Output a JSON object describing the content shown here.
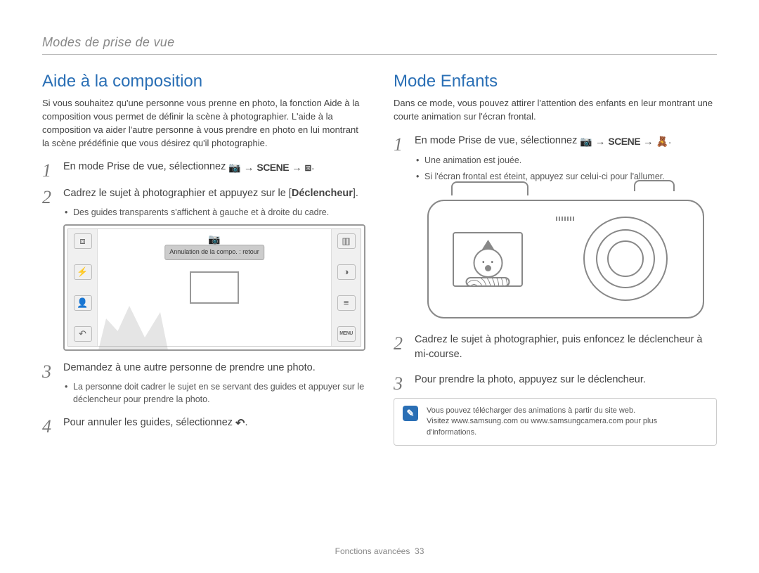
{
  "chapter": "Modes de prise de vue",
  "footer": {
    "section": "Fonctions avancées",
    "page": "33"
  },
  "left": {
    "heading": "Aide à la composition",
    "intro": "Si vous souhaitez qu'une personne vous prenne en photo, la fonction Aide à la composition vous permet de définir la scène à photographier. L'aide à la composition va aider l'autre personne à vous prendre en photo en lui montrant la scène prédéfinie que vous désirez qu'il photographie.",
    "step1_pre": "En mode Prise de vue, sélectionnez ",
    "scene_label": "SCENE",
    "step2_a": "Cadrez le sujet à photographier et appuyez sur le [",
    "step2_b": "Déclencheur",
    "step2_c": "].",
    "step2_bullet": "Des guides transparents s'affichent à gauche et à droite du cadre.",
    "tooltip": "Annulation de la compo. : retour",
    "step3": "Demandez à une autre personne de prendre une photo.",
    "step3_bullet": "La personne doit cadrer le sujet en se servant des guides et appuyer sur le déclencheur pour prendre la photo.",
    "step4_pre": "Pour annuler les guides, sélectionnez ",
    "lcd_left_icons": [
      "⧈",
      "⚡",
      "👤",
      "↶"
    ],
    "lcd_top": "📷",
    "lcd_right_icons": [
      "▥",
      "◑",
      "≡"
    ],
    "menu_label": "MENU"
  },
  "right": {
    "heading": "Mode Enfants",
    "intro": "Dans ce mode, vous pouvez attirer l'attention des enfants en leur montrant une courte animation sur l'écran frontal.",
    "step1_pre": "En mode Prise de vue, sélectionnez ",
    "scene_label": "SCENE",
    "step1_b1": "Une animation est jouée.",
    "step1_b2": "Si l'écran frontal est éteint, appuyez sur celui-ci pour l'allumer.",
    "step2": "Cadrez le sujet à photographier, puis enfoncez le déclencheur à mi-course.",
    "step3": "Pour prendre la photo, appuyez sur le déclencheur.",
    "note_line1": "Vous pouvez télécharger des animations à partir du site web.",
    "note_line2": "Visitez www.samsung.com ou www.samsungcamera.com pour plus d'informations."
  }
}
